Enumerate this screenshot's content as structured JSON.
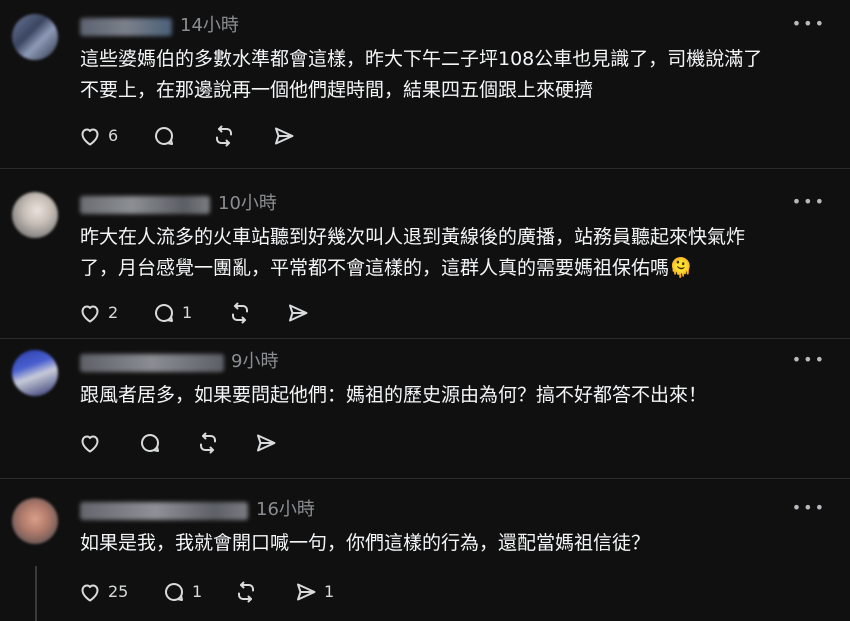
{
  "comments": [
    {
      "time": "14小時",
      "more": "•••",
      "lines": [
        "這些婆媽伯的多數水準都會這樣，昨大下午二子坪108公車也見識了，司機說滿了",
        "不要上，在那邊說再一個他們趕時間，結果四五個跟上來硬擠"
      ],
      "like_count": "6",
      "reply_count": "",
      "repost_count": "",
      "share_count": ""
    },
    {
      "time": "10小時",
      "more": "•••",
      "lines": [
        "昨大在人流多的火車站聽到好幾次叫人退到黃線後的廣播，站務員聽起來快氣炸",
        "了，月台感覺一團亂，平常都不會這樣的，這群人真的需要媽祖保佑嗎🫠"
      ],
      "like_count": "2",
      "reply_count": "1",
      "repost_count": "",
      "share_count": ""
    },
    {
      "time": "9小時",
      "more": "•••",
      "lines": [
        "跟風者居多，如果要問起他們：媽祖的歷史源由為何？搞不好都答不出來！"
      ],
      "like_count": "",
      "reply_count": "",
      "repost_count": "",
      "share_count": ""
    },
    {
      "time": "16小時",
      "more": "•••",
      "lines": [
        "如果是我，我就會開口喊一句，你們這樣的行為，還配當媽祖信徒？"
      ],
      "like_count": "25",
      "reply_count": "1",
      "repost_count": "",
      "share_count": "1"
    }
  ],
  "icons": {
    "like": "heart-icon",
    "reply": "speech-bubble-icon",
    "repost": "repost-icon",
    "share": "send-icon",
    "more": "more-options-icon"
  },
  "colors": {
    "background": "#101010",
    "text": "#f3f5f7",
    "secondary": "#8a8d91",
    "divider": "#2b2b2b"
  }
}
